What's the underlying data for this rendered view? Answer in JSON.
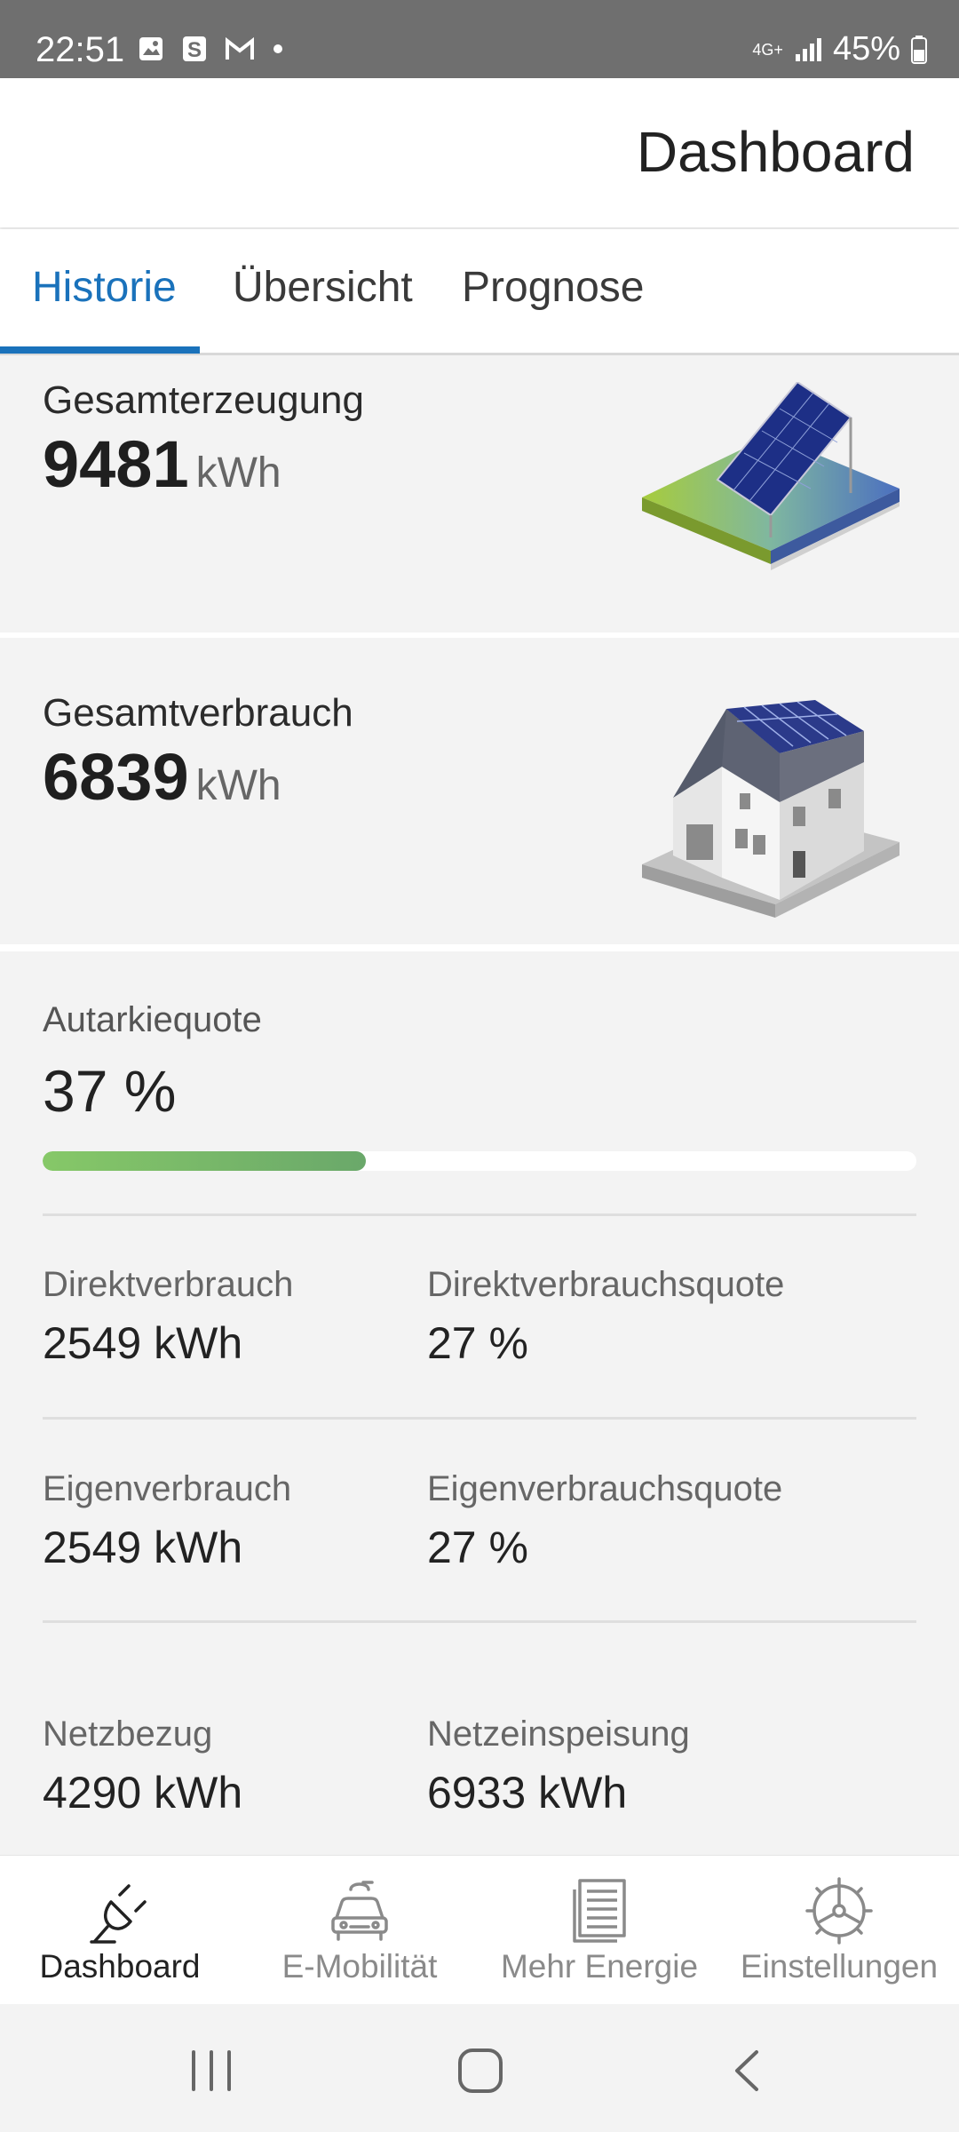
{
  "status_bar": {
    "time": "22:51",
    "network": "4G+",
    "battery": "45%"
  },
  "app_bar": {
    "title": "Dashboard"
  },
  "tabs": [
    {
      "label": "Historie",
      "active": true
    },
    {
      "label": "Übersicht",
      "active": false
    },
    {
      "label": "Prognose",
      "active": false
    }
  ],
  "generation": {
    "label": "Gesamterzeugung",
    "value": "9481",
    "unit": "kWh",
    "illustration": "solar-panel-illustration"
  },
  "consumption": {
    "label": "Gesamtverbrauch",
    "value": "6839",
    "unit": "kWh",
    "illustration": "house-illustration"
  },
  "autarky": {
    "label": "Autarkiequote",
    "value": "37 %",
    "fraction": 0.37
  },
  "stats": {
    "direct_use": {
      "label": "Direktverbrauch",
      "value": "2549 kWh"
    },
    "direct_use_rate": {
      "label": "Direktverbrauchsquote",
      "value": "27 %"
    },
    "self_use": {
      "label": "Eigenverbrauch",
      "value": "2549 kWh"
    },
    "self_use_rate": {
      "label": "Eigenverbrauchsquote",
      "value": "27 %"
    },
    "grid_import": {
      "label": "Netzbezug",
      "value": "4290 kWh"
    },
    "grid_feed_in": {
      "label": "Netzeinspeisung",
      "value": "6933 kWh"
    }
  },
  "bottom_nav": [
    {
      "label": "Dashboard",
      "icon": "plug-icon",
      "active": true
    },
    {
      "label": "E-Mobilität",
      "icon": "car-charging-icon",
      "active": false
    },
    {
      "label": "Mehr Energie",
      "icon": "document-icon",
      "active": false
    },
    {
      "label": "Einstellungen",
      "icon": "settings-wheel-icon",
      "active": false
    }
  ],
  "colors": {
    "accent": "#1a72bb",
    "progress": "#86c868",
    "status_bar": "#6f6f6f"
  }
}
